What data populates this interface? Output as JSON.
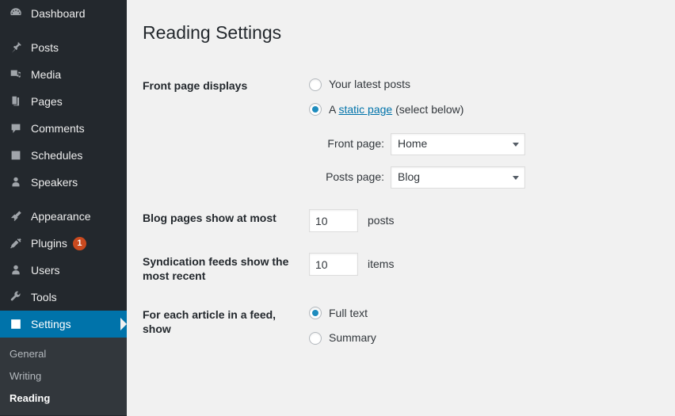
{
  "sidebar": {
    "items": [
      {
        "label": "Dashboard",
        "icon": "dashboard-icon",
        "name": "sidebar-item-dashboard"
      },
      {
        "label": "Posts",
        "icon": "pin-icon",
        "name": "sidebar-item-posts"
      },
      {
        "label": "Media",
        "icon": "media-icon",
        "name": "sidebar-item-media"
      },
      {
        "label": "Pages",
        "icon": "pages-icon",
        "name": "sidebar-item-pages"
      },
      {
        "label": "Comments",
        "icon": "comment-icon",
        "name": "sidebar-item-comments"
      },
      {
        "label": "Schedules",
        "icon": "calendar-icon",
        "name": "sidebar-item-schedules"
      },
      {
        "label": "Speakers",
        "icon": "user-icon",
        "name": "sidebar-item-speakers"
      },
      {
        "label": "Appearance",
        "icon": "brush-icon",
        "name": "sidebar-item-appearance"
      },
      {
        "label": "Plugins",
        "icon": "plug-icon",
        "name": "sidebar-item-plugins",
        "badge": "1"
      },
      {
        "label": "Users",
        "icon": "users-icon",
        "name": "sidebar-item-users"
      },
      {
        "label": "Tools",
        "icon": "wrench-icon",
        "name": "sidebar-item-tools"
      },
      {
        "label": "Settings",
        "icon": "sliders-icon",
        "name": "sidebar-item-settings",
        "current": true
      }
    ],
    "submenu": [
      {
        "label": "General",
        "name": "submenu-item-general"
      },
      {
        "label": "Writing",
        "name": "submenu-item-writing"
      },
      {
        "label": "Reading",
        "name": "submenu-item-reading",
        "active": true
      }
    ],
    "badge_color": "#ca4a1f",
    "current_color": "#0073aa"
  },
  "page": {
    "title": "Reading Settings"
  },
  "form": {
    "front_page_displays": {
      "label": "Front page displays",
      "option_latest_posts": "Your latest posts",
      "latest_posts_checked": false,
      "static_page_checked": true,
      "static_prefix": "A ",
      "static_link": "static page",
      "static_suffix": " (select below)",
      "front_page_label": "Front page:",
      "front_page_value": "Home",
      "posts_page_label": "Posts page:",
      "posts_page_value": "Blog"
    },
    "blog_pages": {
      "label": "Blog pages show at most",
      "value": "10",
      "unit": "posts"
    },
    "syndication": {
      "label": "Syndication feeds show the most recent",
      "value": "10",
      "unit": "items"
    },
    "article_feed": {
      "label": "For each article in a feed, show",
      "option_full_text": "Full text",
      "full_text_checked": true,
      "option_summary": "Summary",
      "summary_checked": false
    }
  }
}
